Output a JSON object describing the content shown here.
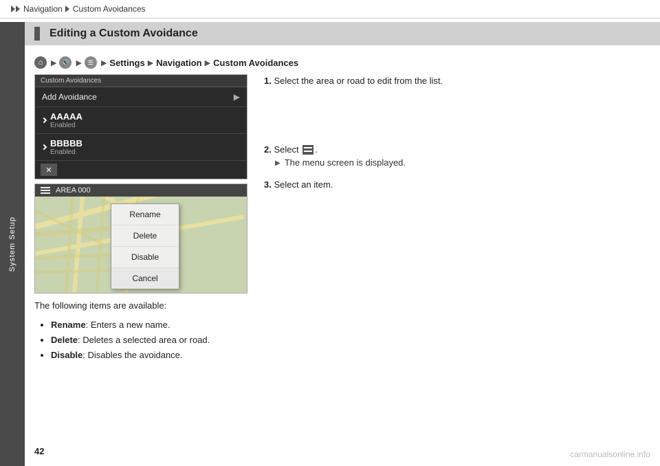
{
  "topbar": {
    "breadcrumbs": [
      "Navigation",
      "Custom Avoidances"
    ]
  },
  "sidebar": {
    "label": "System Setup"
  },
  "section": {
    "title": "Editing a Custom Avoidance"
  },
  "path": {
    "items": [
      "Settings",
      "Navigation",
      "Custom Avoidances"
    ]
  },
  "screen1": {
    "header": "Custom Avoidances",
    "add_label": "Add Avoidance",
    "items": [
      {
        "name": "AAAAA",
        "status": "Enabled"
      },
      {
        "name": "BBBBB",
        "status": "Enabled"
      }
    ]
  },
  "screen2": {
    "header": "AREA 000",
    "popup": {
      "items": [
        "Rename",
        "Delete",
        "Disable"
      ],
      "cancel": "Cancel"
    }
  },
  "steps": [
    {
      "num": "1.",
      "text": "Select the area or road to edit from the list."
    },
    {
      "num": "2.",
      "text": "Select",
      "sub": "The menu screen is displayed."
    },
    {
      "num": "3.",
      "text": "Select an item."
    }
  ],
  "following_text": "The following items are available:",
  "bullets": [
    {
      "label": "Rename",
      "desc": "Enters a new name."
    },
    {
      "label": "Delete",
      "desc": "Deletes a selected area or road."
    },
    {
      "label": "Disable",
      "desc": "Disables the avoidance."
    }
  ],
  "page_number": "42",
  "watermark": "carmanualsonline.info"
}
